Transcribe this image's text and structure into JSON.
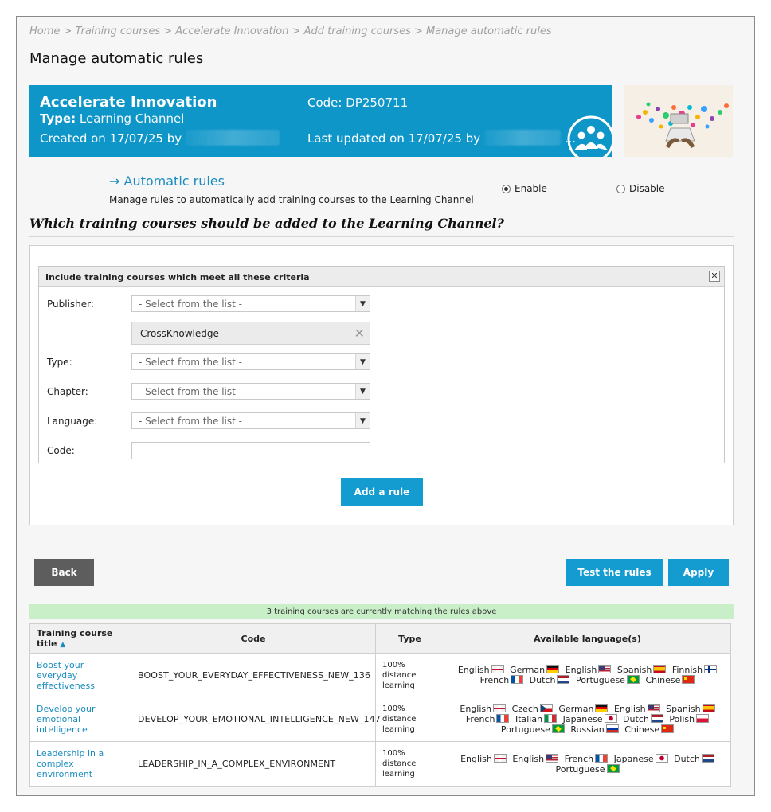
{
  "breadcrumb": "Home > Training courses > Accelerate Innovation > Add training courses > Manage automatic rules",
  "page_title": "Manage automatic rules",
  "banner": {
    "name": "Accelerate Innovation",
    "type_label": "Type:",
    "type_value": "Learning Channel",
    "created": "Created on 17/07/25 by",
    "code_label": "Code:",
    "code_value": "DP250711",
    "updated": "Last updated on 17/07/25 by",
    "updated_suffix": "..."
  },
  "automatic": {
    "title": "Automatic rules",
    "description": "Manage rules to automatically add training courses to the Learning Channel",
    "enable_label": "Enable",
    "disable_label": "Disable",
    "selected": "Enable"
  },
  "question": "Which training courses should be added to the Learning Channel?",
  "criteria": {
    "header": "Include training courses which meet all these criteria",
    "publisher_label": "Publisher:",
    "publisher_value": "- Select from the list -",
    "publisher_tag": "CrossKnowledge",
    "type_label": "Type:",
    "type_value": "- Select from the list -",
    "chapter_label": "Chapter:",
    "chapter_value": "- Select from the list -",
    "language_label": "Language:",
    "language_value": "- Select from the list -",
    "code_label": "Code:",
    "code_value": ""
  },
  "buttons": {
    "add_rule": "Add a rule",
    "back": "Back",
    "test": "Test the rules",
    "apply": "Apply"
  },
  "match_text": "3 training courses are currently matching the rules above",
  "table": {
    "headers": [
      "Training course title",
      "Code",
      "Type",
      "Available language(s)"
    ],
    "sort_indicator": "▲",
    "rows": [
      {
        "title": "Boost your everyday effectiveness",
        "code": "BOOST_YOUR_EVERYDAY_EFFECTIVENESS_NEW_136",
        "type": "100% distance learning",
        "languages": [
          {
            "name": "English",
            "flag": "en"
          },
          {
            "name": "German",
            "flag": "de"
          },
          {
            "name": "English",
            "flag": "us"
          },
          {
            "name": "Spanish",
            "flag": "es"
          },
          {
            "name": "Finnish",
            "flag": "fi"
          },
          {
            "name": "French",
            "flag": "fr"
          },
          {
            "name": "Dutch",
            "flag": "nl"
          },
          {
            "name": "Portuguese",
            "flag": "br"
          },
          {
            "name": "Chinese",
            "flag": "cn"
          }
        ]
      },
      {
        "title": "Develop your emotional intelligence",
        "code": "DEVELOP_YOUR_EMOTIONAL_INTELLIGENCE_NEW_147",
        "type": "100% distance learning",
        "languages": [
          {
            "name": "English",
            "flag": "en"
          },
          {
            "name": "Czech",
            "flag": "cz"
          },
          {
            "name": "German",
            "flag": "de"
          },
          {
            "name": "English",
            "flag": "us"
          },
          {
            "name": "Spanish",
            "flag": "es"
          },
          {
            "name": "French",
            "flag": "fr"
          },
          {
            "name": "Italian",
            "flag": "it"
          },
          {
            "name": "Japanese",
            "flag": "jp"
          },
          {
            "name": "Dutch",
            "flag": "nl"
          },
          {
            "name": "Polish",
            "flag": "pl"
          },
          {
            "name": "Portuguese",
            "flag": "br"
          },
          {
            "name": "Russian",
            "flag": "ru"
          },
          {
            "name": "Chinese",
            "flag": "cn"
          }
        ]
      },
      {
        "title": "Leadership in a complex environment",
        "code": "LEADERSHIP_IN_A_COMPLEX_ENVIRONMENT",
        "type": "100% distance learning",
        "languages": [
          {
            "name": "English",
            "flag": "en"
          },
          {
            "name": "English",
            "flag": "us"
          },
          {
            "name": "French",
            "flag": "fr"
          },
          {
            "name": "Japanese",
            "flag": "jp"
          },
          {
            "name": "Dutch",
            "flag": "nl"
          },
          {
            "name": "Portuguese",
            "flag": "br"
          }
        ]
      }
    ]
  }
}
